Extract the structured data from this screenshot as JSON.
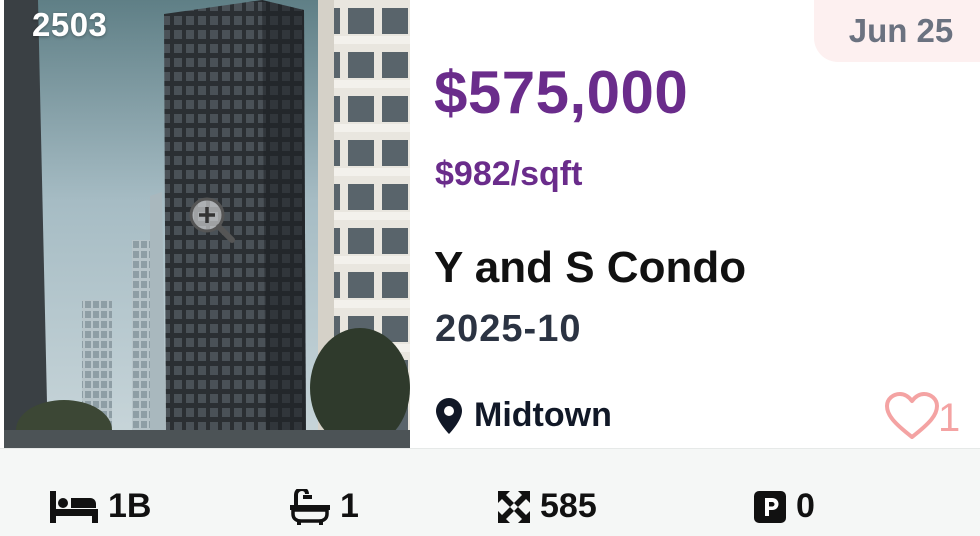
{
  "listing": {
    "unit": "2503",
    "date": "Jun 25",
    "price": "$575,000",
    "price_per_sqft": "$982/sqft",
    "name": "Y and S Condo",
    "occupancy": "2025-10",
    "location": "Midtown",
    "favorites": "1"
  },
  "stats": {
    "beds": "1B",
    "baths": "1",
    "sqft": "585",
    "parking": "0"
  },
  "icons": {
    "zoom": "zoom-in-icon",
    "location": "map-pin-icon",
    "favorite": "heart-icon",
    "beds": "bed-icon",
    "baths": "bath-icon",
    "sqft": "expand-arrows-icon",
    "parking": "parking-icon"
  },
  "colors": {
    "price": "#6a2c8b",
    "date_tag_bg": "#fdf0f0",
    "heart": "#f4a3a3",
    "stats_bg": "#f5f7f6"
  }
}
